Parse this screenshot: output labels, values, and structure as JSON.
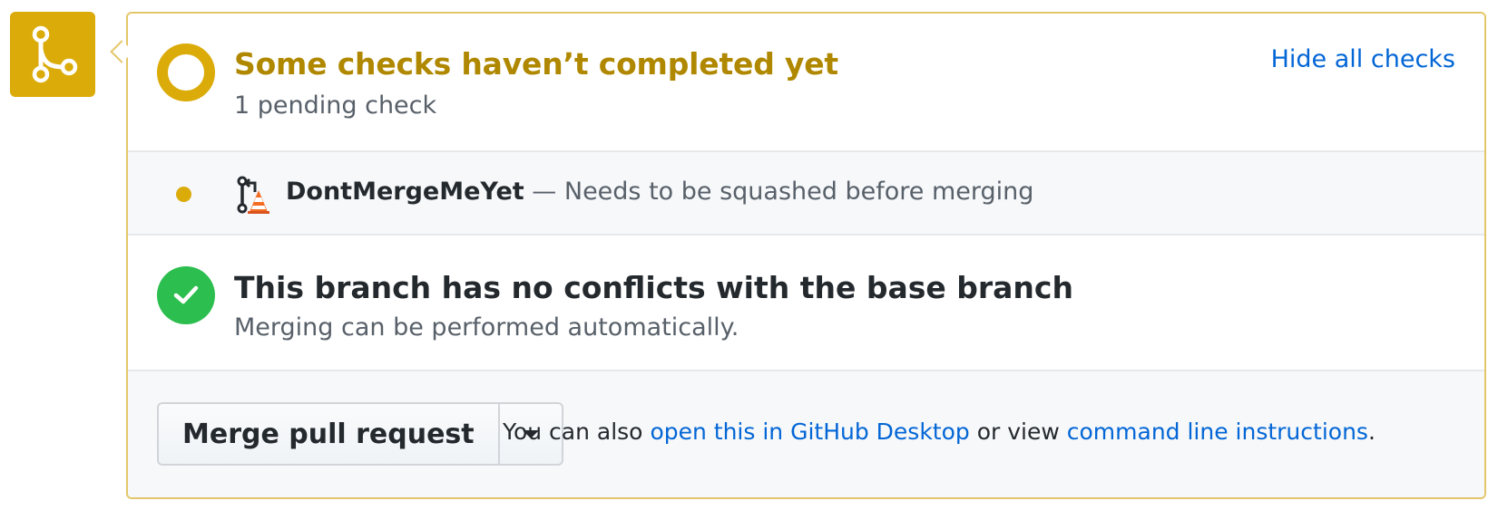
{
  "checks": {
    "title": "Some checks haven’t completed yet",
    "subtitle": "1 pending check",
    "toggle_label": "Hide all checks",
    "items": [
      {
        "name": "DontMergeMeYet",
        "separator": " — ",
        "description": "Needs to be squashed before merging",
        "status": "pending",
        "avatar_icon": "pull-request-traffic-cone-icon"
      }
    ]
  },
  "conflicts": {
    "title": "This branch has no conflicts with the base branch",
    "subtitle": "Merging can be performed automatically."
  },
  "merge": {
    "button_label": "Merge pull request",
    "dropdown_icon": "caret-down-icon",
    "text_prefix": "You can also ",
    "desktop_link": "open this in GitHub Desktop",
    "text_middle": " or view ",
    "cli_link": "command line instructions",
    "text_suffix": "."
  },
  "colors": {
    "pending": "#dbab09",
    "pending_text": "#b08800",
    "success": "#2cbe4e",
    "link": "#0366d6"
  }
}
